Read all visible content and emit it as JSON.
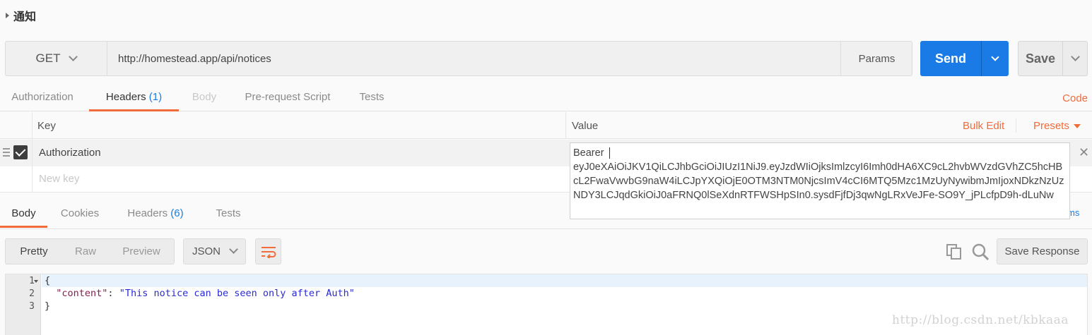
{
  "collection": {
    "title": "通知"
  },
  "request": {
    "method": "GET",
    "url": "http://homestead.app/api/notices",
    "params_label": "Params",
    "send_label": "Send",
    "save_label": "Save"
  },
  "request_tabs": [
    {
      "label": "Authorization"
    },
    {
      "label": "Headers",
      "count": "(1)"
    },
    {
      "label": "Body"
    },
    {
      "label": "Pre-request Script"
    },
    {
      "label": "Tests"
    }
  ],
  "code_link": "Code",
  "headers_table": {
    "key_col": "Key",
    "value_col": "Value",
    "bulk_edit": "Bulk Edit",
    "presets": "Presets",
    "rows": [
      {
        "key": "Authorization",
        "checked": true
      }
    ],
    "new_key_placeholder": "New key",
    "value_popup": "Bearer \neyJ0eXAiOiJKV1QiLCJhbGciOiJIUzI1NiJ9.eyJzdWIiOjksImlzcyI6Imh0dHA6XC9cL2hvbWVzdGVhZC5hcHBcL2FwaVwvbG9naW4iLCJpYXQiOjE0OTM3NTM0NjcsImV4cCI6MTQ5Mzc1MzUyNywibmJmIjoxNDkzNzUzNDY3LCJqdGkiOiJ0aFRNQ0lSeXdnRTFWSHpSIn0.sysdFjfDj3qwNgLRxVeJFe-SO9Y_jPLcfpD9h-dLuNw"
  },
  "response_tabs": [
    {
      "label": "Body"
    },
    {
      "label": "Cookies"
    },
    {
      "label": "Headers",
      "count": "(6)"
    },
    {
      "label": "Tests"
    }
  ],
  "response_status_fragment": "ms",
  "response_toolbar": {
    "views": [
      "Pretty",
      "Raw",
      "Preview"
    ],
    "format": "JSON",
    "save_response": "Save Response"
  },
  "response_body": {
    "line_numbers": [
      "1",
      "2",
      "3"
    ],
    "open_brace": "{",
    "key": "\"content\"",
    "colon": ": ",
    "value": "\"This notice can be seen only after Auth\"",
    "close_brace": "}"
  },
  "watermark": "http://blog.csdn.net/kbkaaa",
  "colors": {
    "accent": "#f26b3a",
    "primary": "#1a7be6"
  }
}
